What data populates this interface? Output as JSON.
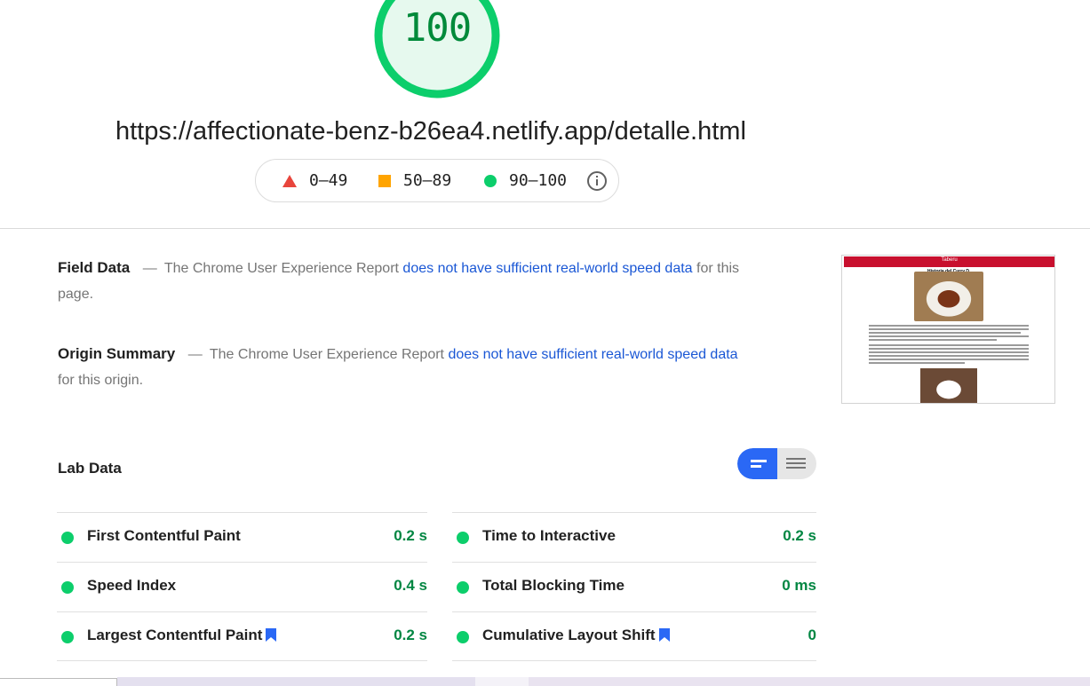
{
  "score": {
    "value": "100",
    "color": "#0cce6b",
    "ring_fill": "#e6f9ee"
  },
  "url": "https://affectionate-benz-b26ea4.netlify.app/detalle.html",
  "legend": {
    "poor": "0–49",
    "average": "50–89",
    "good": "90–100",
    "info_icon": "info-icon"
  },
  "field_data": {
    "heading": "Field Data",
    "dash": "—",
    "text_before": "The Chrome User Experience Report",
    "link": "does not have sufficient real-world speed data",
    "text_after": "for this page."
  },
  "origin_summary": {
    "heading": "Origin Summary",
    "dash": "—",
    "text_before": "The Chrome User Experience Report",
    "link": "does not have sufficient real-world speed data",
    "text_after": "for this origin."
  },
  "thumbnail": {
    "title": "Taberu",
    "subtitle": "Historia del Curry D"
  },
  "lab_data": {
    "heading": "Lab Data",
    "metrics_left": [
      {
        "label": "First Contentful Paint",
        "value": "0.2 s",
        "bookmark": false
      },
      {
        "label": "Speed Index",
        "value": "0.4 s",
        "bookmark": false
      },
      {
        "label": "Largest Contentful Paint",
        "value": "0.2 s",
        "bookmark": true
      }
    ],
    "metrics_right": [
      {
        "label": "Time to Interactive",
        "value": "0.2 s",
        "bookmark": false
      },
      {
        "label": "Total Blocking Time",
        "value": "0 ms",
        "bookmark": false
      },
      {
        "label": "Cumulative Layout Shift",
        "value": "0",
        "bookmark": true
      }
    ]
  },
  "colors": {
    "good": "#0cce6b",
    "average": "#ffa400",
    "poor": "#e8453c",
    "link": "#1a57d5",
    "value": "#018642",
    "toggle_active": "#2a68f5"
  }
}
